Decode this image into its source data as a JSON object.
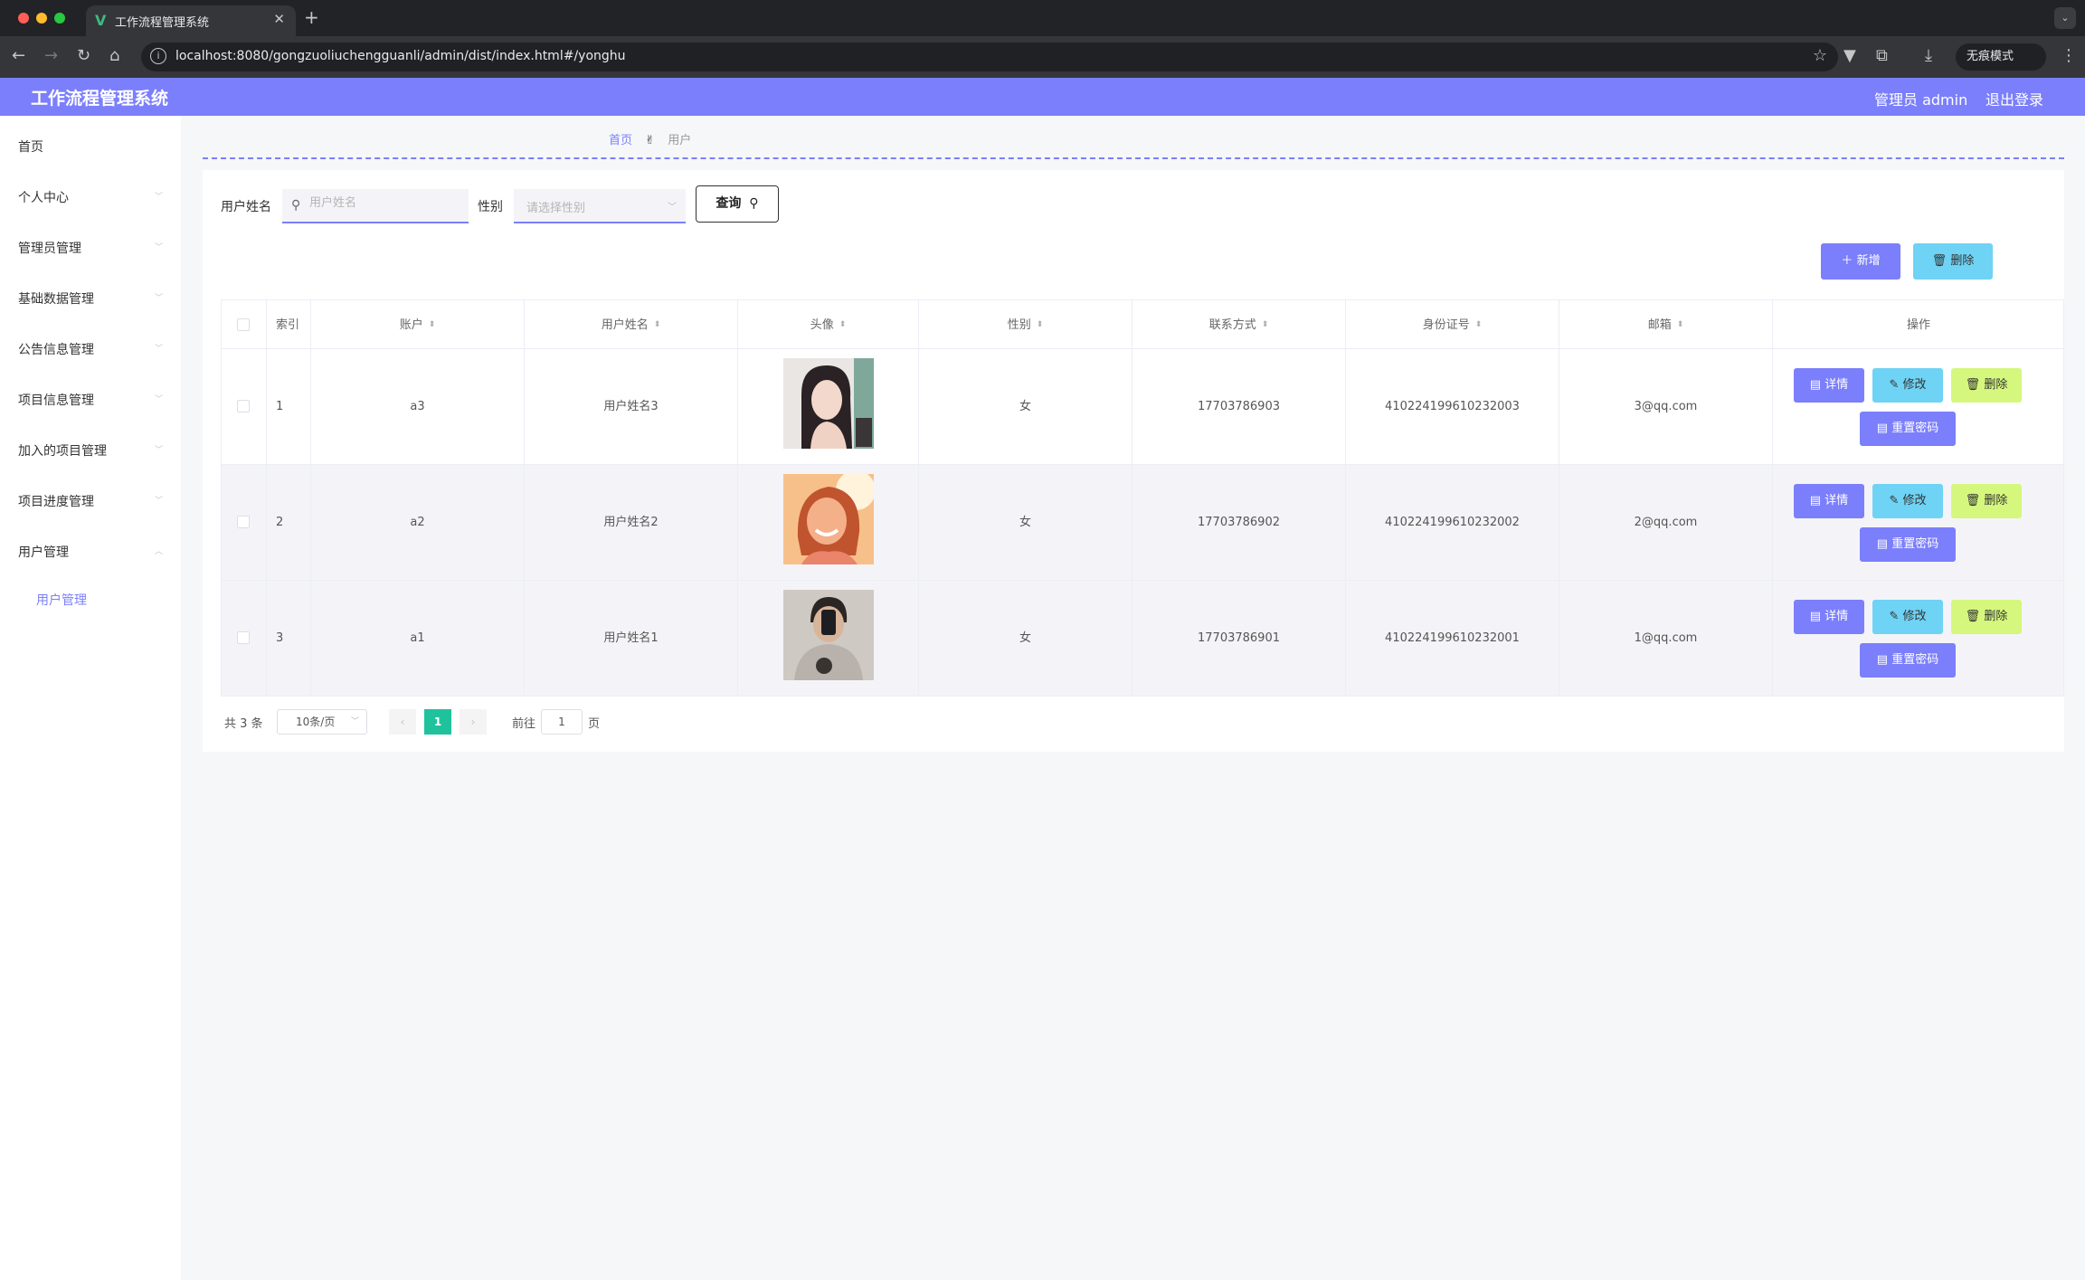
{
  "browser": {
    "tab_title": "工作流程管理系统",
    "tab_favicon": "V",
    "url": "localhost:8080/gongzuoliuchengguanli/admin/dist/index.html#/yonghu",
    "incognito_label": "无痕模式"
  },
  "header": {
    "title": "工作流程管理系统",
    "user_label": "管理员 admin",
    "logout_label": "退出登录"
  },
  "sidebar": {
    "items": [
      {
        "label": "首页"
      },
      {
        "label": "个人中心"
      },
      {
        "label": "管理员管理"
      },
      {
        "label": "基础数据管理"
      },
      {
        "label": "公告信息管理"
      },
      {
        "label": "项目信息管理"
      },
      {
        "label": "加入的项目管理"
      },
      {
        "label": "项目进度管理"
      },
      {
        "label": "用户管理"
      }
    ],
    "active_sub": "用户管理"
  },
  "breadcrumb": {
    "home": "首页",
    "separator": "✌",
    "current": "用户"
  },
  "search": {
    "name_label": "用户姓名",
    "name_placeholder": "用户姓名",
    "gender_label": "性别",
    "gender_placeholder": "请选择性别",
    "query_label": "查询"
  },
  "actions": {
    "add_label": "新增",
    "delete_label": "删除"
  },
  "table": {
    "columns": [
      "索引",
      "账户",
      "用户姓名",
      "头像",
      "性别",
      "联系方式",
      "身份证号",
      "邮箱",
      "操作"
    ],
    "rows": [
      {
        "index": "1",
        "account": "a3",
        "name": "用户姓名3",
        "avatar": "avatar-woman-illustration",
        "gender": "女",
        "phone": "17703786903",
        "id_card": "410224199610232003",
        "email": "3@qq.com"
      },
      {
        "index": "2",
        "account": "a2",
        "name": "用户姓名2",
        "avatar": "avatar-woman-smiling",
        "gender": "女",
        "phone": "17703786902",
        "id_card": "410224199610232002",
        "email": "2@qq.com"
      },
      {
        "index": "3",
        "account": "a1",
        "name": "用户姓名1",
        "avatar": "avatar-man-selfie",
        "gender": "女",
        "phone": "17703786901",
        "id_card": "410224199610232001",
        "email": "1@qq.com"
      }
    ],
    "row_actions": {
      "detail": "详情",
      "edit": "修改",
      "delete": "删除",
      "reset": "重置密码"
    }
  },
  "pagination": {
    "total": "共 3 条",
    "page_size": "10条/页",
    "current_page": "1",
    "goto_label": "前往",
    "goto_value": "1",
    "page_suffix": "页"
  },
  "colors": {
    "primary": "#7b7ffb",
    "info": "#6ed3f5",
    "lime": "#d5f77d",
    "pager_active": "#1fc29c"
  }
}
